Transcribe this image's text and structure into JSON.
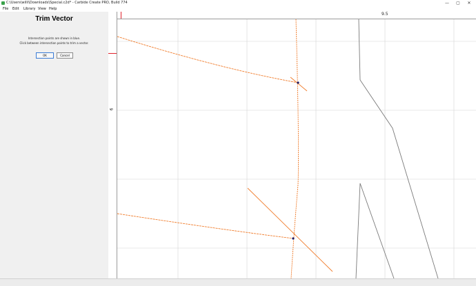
{
  "window": {
    "title": "C:\\Users\\willi\\Downloads\\Special.c2d* - Carbide Create PRO, Build 774",
    "minimize_glyph": "—",
    "maximize_glyph": "▢",
    "close_glyph": "✕"
  },
  "menu": [
    "File",
    "Edit",
    "Library",
    "View",
    "Help"
  ],
  "panel": {
    "title": "Trim Vector",
    "line1": "Intersection points are shown in blue.",
    "line2": "Click between intersection points to trim a vector.",
    "ok_label": "OK",
    "cancel_label": "Cancel"
  },
  "rulers": {
    "x_label": "9.5",
    "y_label": "6"
  },
  "colors": {
    "vector_orange": "#f07b2a",
    "vector_gray": "#7a7a7a",
    "grid": "#d4d4d4",
    "ruler_marker": "#e0202a"
  }
}
